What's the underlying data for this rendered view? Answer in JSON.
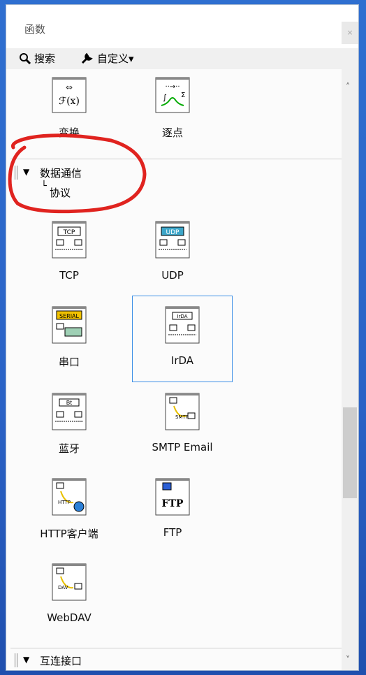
{
  "window": {
    "title": "函数",
    "close_symbol": "×"
  },
  "toolbar": {
    "search_label": "搜索",
    "customize_label": "自定义▾"
  },
  "sections": {
    "transform_row": [
      {
        "label": "变换",
        "icon": "transform-icon"
      },
      {
        "label": "逐点",
        "icon": "pointwise-icon"
      }
    ],
    "data_comm": {
      "title": "数据通信",
      "subpath": "协议",
      "items": [
        {
          "label": "TCP",
          "icon": "tcp-icon"
        },
        {
          "label": "UDP",
          "icon": "udp-icon"
        },
        {
          "label": "串口",
          "icon": "serial-icon"
        },
        {
          "label": "IrDA",
          "icon": "irda-icon"
        },
        {
          "label": "蓝牙",
          "icon": "bluetooth-icon"
        },
        {
          "label": "SMTP Email",
          "icon": "smtp-icon"
        },
        {
          "label": "HTTP客户端",
          "icon": "http-client-icon"
        },
        {
          "label": "FTP",
          "icon": "ftp-icon"
        },
        {
          "label": "WebDAV",
          "icon": "webdav-icon"
        }
      ]
    },
    "interconnect": {
      "title": "互连接口"
    }
  },
  "colors": {
    "selection": "#3b8ee6",
    "annotation": "#e0231f",
    "desktop": "#2a62c6"
  }
}
